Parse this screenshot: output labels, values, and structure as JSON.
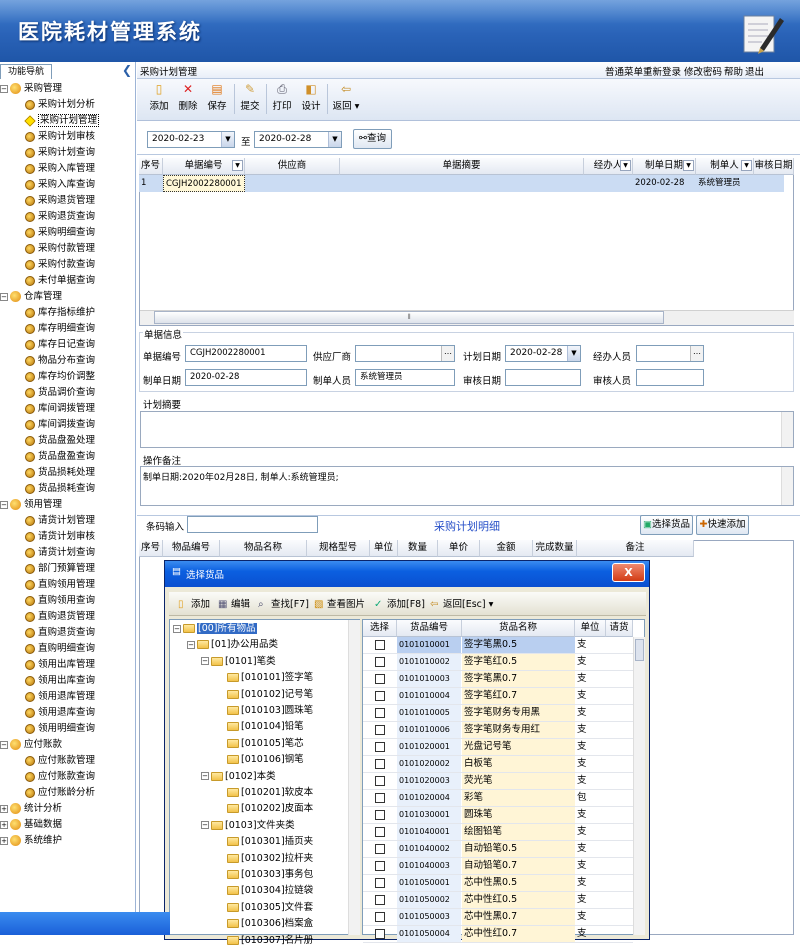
{
  "app": {
    "title": "医院耗材管理系统"
  },
  "nav": {
    "tab_label": "功能导航",
    "groups": [
      {
        "label": "采购管理",
        "items": [
          "采购计划分析",
          "采购计划管理",
          "采购计划审核",
          "采购计划查询",
          "采购入库管理",
          "采购入库查询",
          "采购退货管理",
          "采购退货查询",
          "采购明细查询",
          "采购付款管理",
          "采购付款查询",
          "未付单据查询"
        ]
      },
      {
        "label": "仓库管理",
        "items": [
          "库存指标维护",
          "库存明细查询",
          "库存日记查询",
          "物品分布查询",
          "库存均价调整",
          "货品调价查询",
          "库间调拨管理",
          "库间调拨查询",
          "货品盘盈处理",
          "货品盘盈查询",
          "货品损耗处理",
          "货品损耗查询"
        ]
      },
      {
        "label": "领用管理",
        "items": [
          "请货计划管理",
          "请货计划审核",
          "请货计划查询",
          "部门预算管理",
          "直购领用管理",
          "直购领用查询",
          "直购退货管理",
          "直购退货查询",
          "直购明细查询",
          "领用出库管理",
          "领用出库查询",
          "领用退库管理",
          "领用退库查询",
          "领用明细查询"
        ]
      },
      {
        "label": "应付账款",
        "items": [
          "应付账款管理",
          "应付账款查询",
          "应付账龄分析"
        ]
      },
      {
        "label": "统计分析",
        "items": []
      },
      {
        "label": "基础数据",
        "items": []
      },
      {
        "label": "系统维护",
        "items": []
      }
    ],
    "selected": "采购计划管理"
  },
  "header": {
    "page_title": "采购计划管理",
    "links": [
      "普通菜单",
      "重新登录",
      "修改密码",
      "帮助",
      "退出"
    ]
  },
  "toolbar": {
    "buttons": [
      {
        "label": "添加",
        "icon": "add-document-icon"
      },
      {
        "label": "删除",
        "icon": "delete-x-icon"
      },
      {
        "label": "保存",
        "icon": "save-icon"
      },
      {
        "label": "提交",
        "icon": "submit-icon"
      },
      {
        "label": "打印",
        "icon": "print-icon"
      },
      {
        "label": "设计",
        "icon": "design-icon"
      },
      {
        "label": "返回",
        "icon": "return-icon"
      }
    ]
  },
  "filter": {
    "date_from": "2020-02-23",
    "to_label": "至",
    "date_to": "2020-02-28",
    "query_label": "查询"
  },
  "grid1": {
    "columns": [
      "序号",
      "单据编号",
      "供应商",
      "单据摘要",
      "经办人",
      "制单日期",
      "制单人",
      "审核日期"
    ],
    "rows": [
      {
        "seq": "1",
        "doc_no": "CGJH2002280001",
        "supplier": "",
        "summary": "",
        "handler": "",
        "make_date": "2020-02-28",
        "maker": "系统管理员",
        "audit_date": ""
      }
    ],
    "scroll_glyph": "⦀"
  },
  "doc_info": {
    "legend": "单据信息",
    "doc_no_label": "单据编号",
    "doc_no": "CGJH2002280001",
    "supplier_label": "供应厂商",
    "supplier": "",
    "plan_date_label": "计划日期",
    "plan_date": "2020-02-28",
    "handler_label": "经办人员",
    "handler": "",
    "make_date_label": "制单日期",
    "make_date": "2020-02-28",
    "maker_label": "制单人员",
    "maker": "系统管理员",
    "audit_date_label": "审核日期",
    "audit_date": "",
    "auditor_label": "审核人员",
    "auditor": ""
  },
  "plan_summary": {
    "legend": "计划摘要",
    "text": ""
  },
  "op_note": {
    "legend": "操作备注",
    "text": "制单日期:2020年02月28日, 制单人:系统管理员;"
  },
  "detail": {
    "barcode_label": "条码输入",
    "barcode_value": "",
    "section_title": "采购计划明细",
    "select_btn": "选择货品",
    "quick_btn": "快速添加",
    "columns": [
      "序号",
      "物品编号",
      "物品名称",
      "规格型号",
      "单位",
      "数量",
      "单价",
      "金额",
      "完成数量",
      "备注"
    ]
  },
  "dialog": {
    "title": "选择货品",
    "close": "X",
    "toolbar": [
      "添加",
      "编辑",
      "查找[F7]",
      "查看图片",
      "添加[F8]",
      "返回[Esc]"
    ],
    "tree": [
      {
        "label": "[00]所有物品",
        "level": 0,
        "selected": true
      },
      {
        "label": "[01]办公用品类",
        "level": 1
      },
      {
        "label": "[0101]笔类",
        "level": 2
      },
      {
        "label": "[010101]签字笔",
        "level": 3
      },
      {
        "label": "[010102]记号笔",
        "level": 3
      },
      {
        "label": "[010103]圆珠笔",
        "level": 3
      },
      {
        "label": "[010104]铅笔",
        "level": 3
      },
      {
        "label": "[010105]笔芯",
        "level": 3
      },
      {
        "label": "[010106]钢笔",
        "level": 3
      },
      {
        "label": "[0102]本类",
        "level": 2
      },
      {
        "label": "[010201]软皮本",
        "level": 3
      },
      {
        "label": "[010202]皮面本",
        "level": 3
      },
      {
        "label": "[0103]文件夹类",
        "level": 2
      },
      {
        "label": "[010301]插页夹",
        "level": 3
      },
      {
        "label": "[010302]拉杆夹",
        "level": 3
      },
      {
        "label": "[010303]事务包",
        "level": 3
      },
      {
        "label": "[010304]拉链袋",
        "level": 3
      },
      {
        "label": "[010305]文件套",
        "level": 3
      },
      {
        "label": "[010306]档案盒",
        "level": 3
      },
      {
        "label": "[010307]名片册",
        "level": 3
      }
    ],
    "columns": [
      "选择",
      "货品编号",
      "货品名称",
      "单位",
      "请货"
    ],
    "rows": [
      {
        "code": "0101010001",
        "name": "签字笔黑0.5",
        "unit": "支"
      },
      {
        "code": "0101010002",
        "name": "签字笔红0.5",
        "unit": "支"
      },
      {
        "code": "0101010003",
        "name": "签字笔黑0.7",
        "unit": "支"
      },
      {
        "code": "0101010004",
        "name": "签字笔红0.7",
        "unit": "支"
      },
      {
        "code": "0101010005",
        "name": "签字笔财务专用黑",
        "unit": "支"
      },
      {
        "code": "0101010006",
        "name": "签字笔财务专用红",
        "unit": "支"
      },
      {
        "code": "0101020001",
        "name": "光盘记号笔",
        "unit": "支"
      },
      {
        "code": "0101020002",
        "name": "白板笔",
        "unit": "支"
      },
      {
        "code": "0101020003",
        "name": "荧光笔",
        "unit": "支"
      },
      {
        "code": "0101020004",
        "name": "彩笔",
        "unit": "包"
      },
      {
        "code": "0101030001",
        "name": "圆珠笔",
        "unit": "支"
      },
      {
        "code": "0101040001",
        "name": "绘图铅笔",
        "unit": "支"
      },
      {
        "code": "0101040002",
        "name": "自动铅笔0.5",
        "unit": "支"
      },
      {
        "code": "0101040003",
        "name": "自动铅笔0.7",
        "unit": "支"
      },
      {
        "code": "0101050001",
        "name": "芯中性黑0.5",
        "unit": "支"
      },
      {
        "code": "0101050002",
        "name": "芯中性红0.5",
        "unit": "支"
      },
      {
        "code": "0101050003",
        "name": "芯中性黑0.7",
        "unit": "支"
      },
      {
        "code": "0101050004",
        "name": "芯中性红0.7",
        "unit": "支"
      }
    ]
  }
}
